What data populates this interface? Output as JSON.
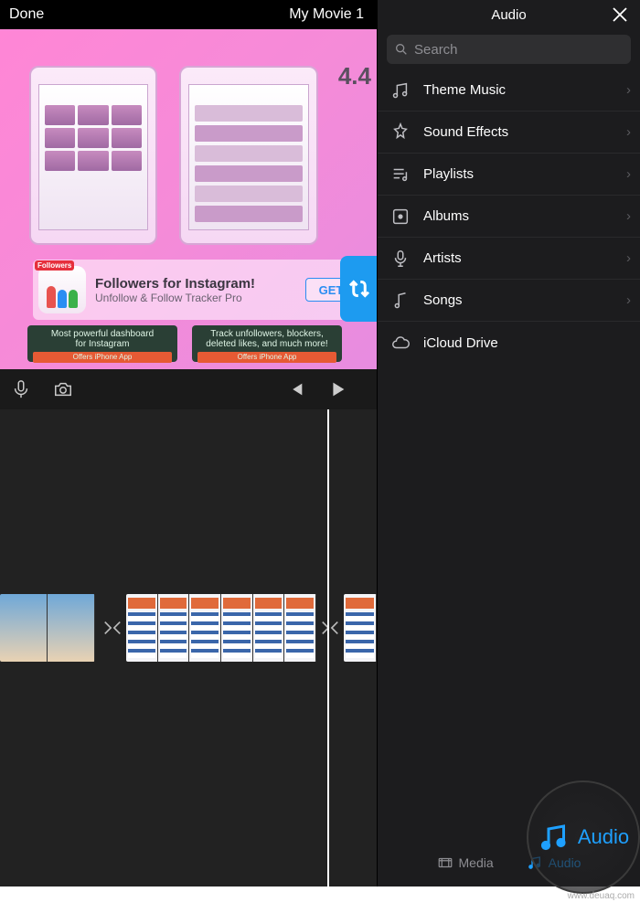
{
  "topbar": {
    "done": "Done",
    "title": "My Movie 1"
  },
  "preview": {
    "rating": "4.4",
    "app_title": "Followers for Instagram!",
    "app_sub": "Unfollow & Follow Tracker Pro",
    "get": "GET",
    "followers_badge": "Followers",
    "promo1_l1": "Most powerful dashboard",
    "promo1_l2": "for Instagram",
    "promo2_l1": "Track unfollowers, blockers,",
    "promo2_l2": "deleted likes, and much more!",
    "promo_bar": "Offers iPhone App"
  },
  "audio_panel": {
    "title": "Audio",
    "search_placeholder": "Search",
    "items": [
      {
        "label": "Theme Music",
        "icon": "theme-music-icon"
      },
      {
        "label": "Sound Effects",
        "icon": "sound-effects-icon"
      },
      {
        "label": "Playlists",
        "icon": "playlists-icon"
      },
      {
        "label": "Albums",
        "icon": "albums-icon"
      },
      {
        "label": "Artists",
        "icon": "artists-icon"
      },
      {
        "label": "Songs",
        "icon": "songs-icon"
      },
      {
        "label": "iCloud Drive",
        "icon": "icloud-icon"
      }
    ]
  },
  "bottom_tabs": {
    "media": "Media",
    "audio": "Audio"
  },
  "watermark": "www.deuaq.com"
}
